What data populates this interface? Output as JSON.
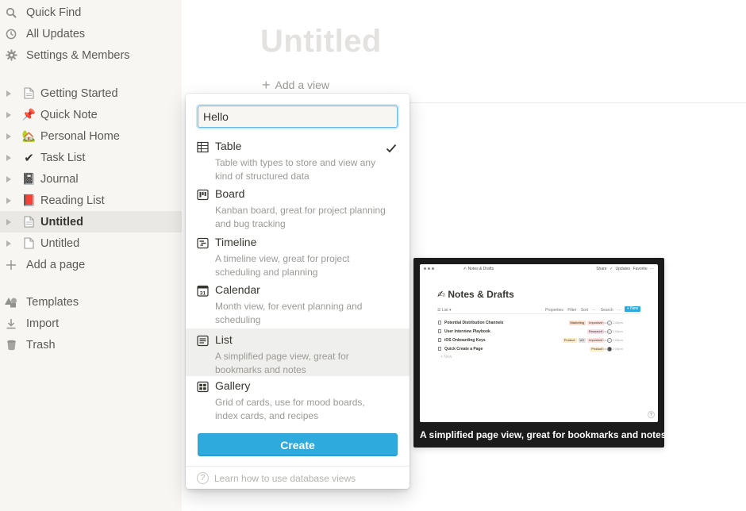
{
  "sidebar": {
    "top_items": [
      {
        "label": "Quick Find",
        "icon": "search-icon"
      },
      {
        "label": "All Updates",
        "icon": "clock-icon"
      },
      {
        "label": "Settings & Members",
        "icon": "gear-icon"
      }
    ],
    "pages": [
      {
        "label": "Getting Started",
        "icon": "page-icon",
        "glyph": ""
      },
      {
        "label": "Quick Note",
        "icon": "pushpin-icon",
        "glyph": "📌"
      },
      {
        "label": "Personal Home",
        "icon": "house-icon",
        "glyph": "🏡"
      },
      {
        "label": "Task List",
        "icon": "checkmark-icon",
        "glyph": "✔"
      },
      {
        "label": "Journal",
        "icon": "notebook-icon",
        "glyph": "📓"
      },
      {
        "label": "Reading List",
        "icon": "red-book-icon",
        "glyph": "📕"
      },
      {
        "label": "Untitled",
        "icon": "page-icon",
        "glyph": "",
        "active": true
      },
      {
        "label": "Untitled",
        "icon": "page-icon",
        "glyph": ""
      }
    ],
    "add_page": "Add a page",
    "bottom_items": [
      {
        "label": "Templates",
        "icon": "shapes-icon"
      },
      {
        "label": "Import",
        "icon": "import-icon"
      },
      {
        "label": "Trash",
        "icon": "trash-icon"
      }
    ]
  },
  "main": {
    "title": "Untitled",
    "add_view": "Add a view"
  },
  "popup": {
    "input_value": "Hello",
    "options": [
      {
        "title": "Table",
        "desc": "Table with types to store and view any kind of structured data",
        "icon": "table-icon",
        "checked": true
      },
      {
        "title": "Board",
        "desc": "Kanban board, great for project planning and bug tracking",
        "icon": "board-icon"
      },
      {
        "title": "Timeline",
        "desc": "A timeline view, great for project scheduling and planning",
        "icon": "timeline-icon"
      },
      {
        "title": "Calendar",
        "desc": "Month view, for event planning and scheduling",
        "icon": "calendar-icon",
        "icon_text": "31"
      },
      {
        "title": "List",
        "desc": "A simplified page view, great for bookmarks and notes",
        "icon": "list-icon",
        "selected": true
      },
      {
        "title": "Gallery",
        "desc": "Grid of cards, use for mood boards, index cards, and recipes",
        "icon": "gallery-icon"
      }
    ],
    "create_label": "Create",
    "help_label": "Learn how to use database views",
    "help_glyph": "?"
  },
  "preview": {
    "crumb": "✍ Notes & Drafts",
    "actions": "Share  ✓ Updates  Favorite  ···",
    "title": "✍ Notes & Drafts",
    "view_label": "☰ List ▾",
    "toolbar": "Properties  Filter  Sort  ··· Search  ···",
    "new_label": "+ New",
    "rows": [
      {
        "name": "Potential Distribution Channels",
        "tags": [
          "Marketing",
          "Important"
        ],
        "time": "Today 12:08pm"
      },
      {
        "name": "User Interview Playbook",
        "tags": [
          "Research"
        ],
        "time": "Today 12:08pm"
      },
      {
        "name": "iOS Onboarding Keys",
        "tags": [
          "Product",
          "UX",
          "Important"
        ],
        "time": "Today 12:08pm"
      },
      {
        "name": "Quick Create a Page",
        "tags": [
          "Product"
        ],
        "time": "Today 12:08pm"
      }
    ],
    "new_row": "+ New",
    "help_glyph": "?",
    "caption": "A simplified page view, great for bookmarks and notes"
  },
  "colors": {
    "accent": "#2eaadc",
    "sidebar_bg": "#f7f6f3",
    "selected_bg": "#efefed"
  }
}
